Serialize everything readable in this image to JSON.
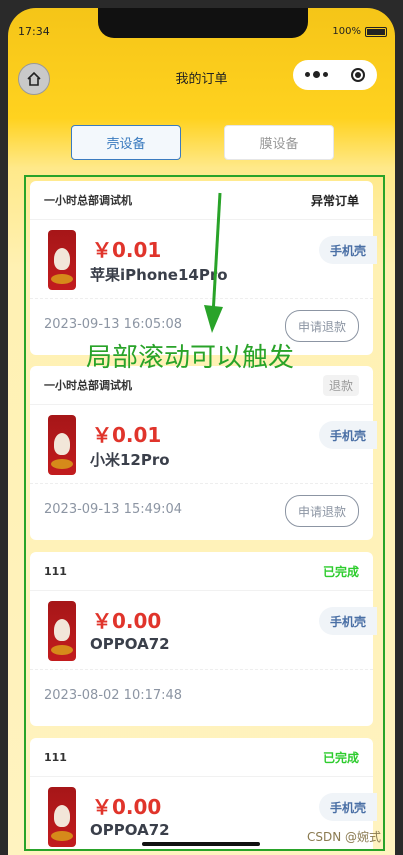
{
  "status_bar": {
    "time": "17:34",
    "battery": "100%"
  },
  "nav": {
    "title": "我的订单"
  },
  "tabs": [
    {
      "label": "壳设备",
      "active": true
    },
    {
      "label": "膜设备",
      "active": false
    }
  ],
  "orders": [
    {
      "store": "一小时总部调试机",
      "status": "异常订单",
      "price": "￥0.01",
      "model": "苹果iPhone14Pro",
      "tag": "手机壳",
      "date": "2023-09-13 16:05:08",
      "action": "申请退款"
    },
    {
      "store": "一小时总部调试机",
      "status": "退款",
      "price": "￥0.01",
      "model": "小米12Pro",
      "tag": "手机壳",
      "date": "2023-09-13 15:49:04",
      "action": "申请退款"
    },
    {
      "store": "111",
      "status": "已完成",
      "price": "￥0.00",
      "model": "OPPOA72",
      "tag": "手机壳",
      "date": "2023-08-02 10:17:48",
      "action": ""
    },
    {
      "store": "111",
      "status": "已完成",
      "price": "￥0.00",
      "model": "OPPOA72",
      "tag": "手机壳",
      "date": "",
      "action": ""
    }
  ],
  "annotation": "局部滚动可以触发",
  "watermark": "CSDN @婉式",
  "colors": {
    "annotation_green": "#29a329",
    "price_red": "#e0342b",
    "done_green": "#2ecc2e",
    "tab_blue": "#3b7bbf"
  }
}
